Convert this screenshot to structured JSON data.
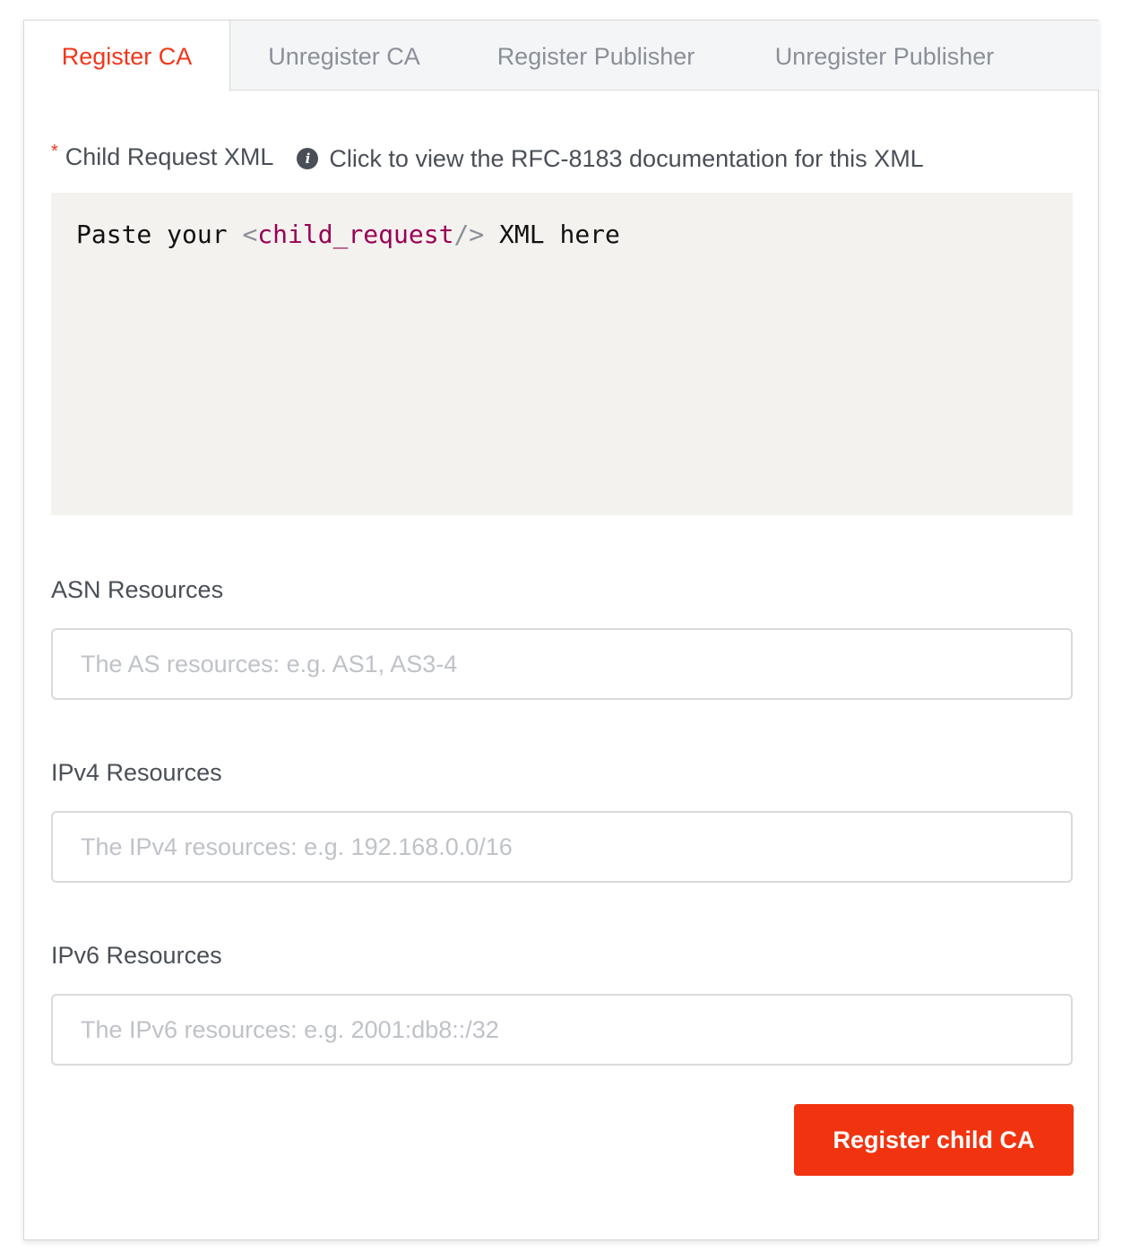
{
  "tabs": [
    {
      "label": "Register CA",
      "active": true
    },
    {
      "label": "Unregister CA",
      "active": false
    },
    {
      "label": "Register Publisher",
      "active": false
    },
    {
      "label": "Unregister Publisher",
      "active": false
    }
  ],
  "form": {
    "child_request": {
      "required_marker": "*",
      "label": "Child Request XML",
      "info_icon": "info-icon",
      "info_text": "Click to view the RFC-8183 documentation for this XML",
      "placeholder_parts": {
        "before": "Paste your ",
        "open_bracket": "<",
        "tag": "child_request",
        "close_bracket": "/>",
        "after": " XML here"
      }
    },
    "asn": {
      "label": "ASN Resources",
      "placeholder": "The AS resources: e.g. AS1, AS3-4",
      "value": ""
    },
    "ipv4": {
      "label": "IPv4 Resources",
      "placeholder": "The IPv4 resources: e.g. 192.168.0.0/16",
      "value": ""
    },
    "ipv6": {
      "label": "IPv6 Resources",
      "placeholder": "The IPv6 resources: e.g. 2001:db8::/32",
      "value": ""
    },
    "submit_label": "Register child CA"
  },
  "colors": {
    "accent": "#f2361b",
    "button": "#f2330f",
    "editor_bg": "#f4f2ef",
    "tab_bar_bg": "#f4f5f7"
  }
}
